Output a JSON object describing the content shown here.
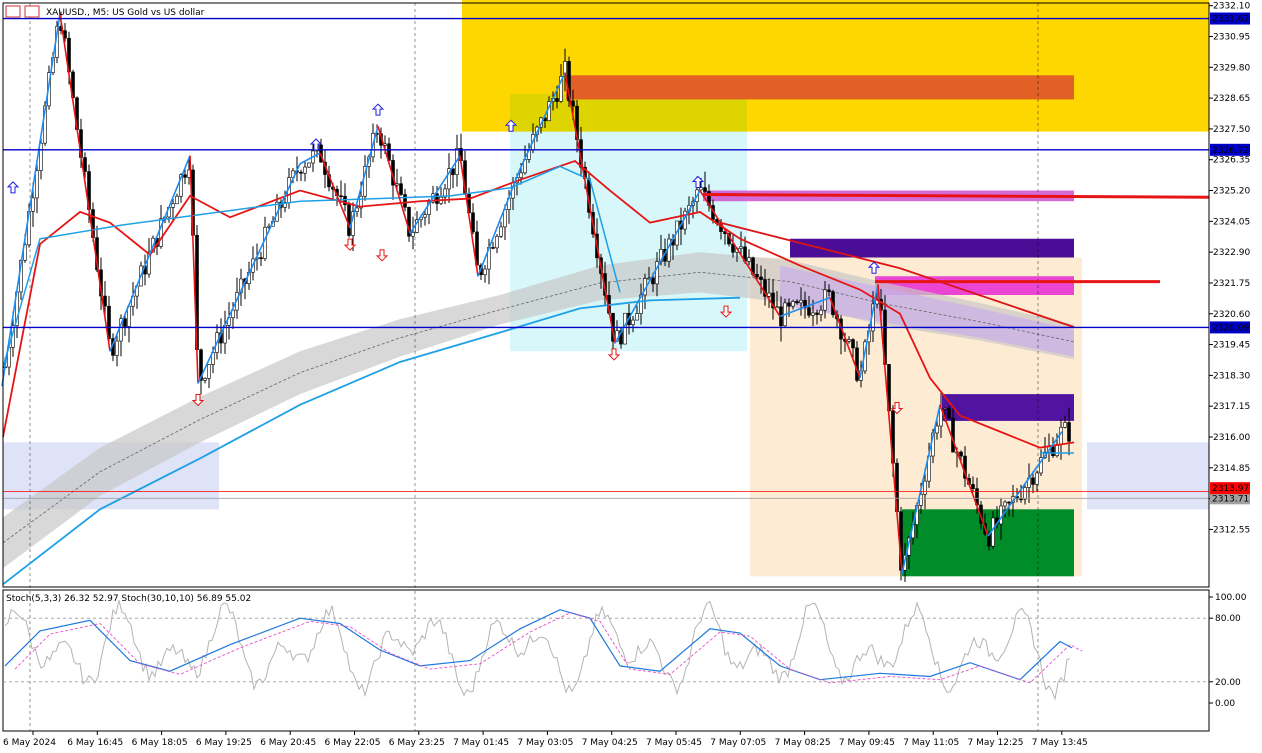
{
  "header": {
    "symbol_text": "XAUUSD., M5:  US Gold vs US dollar"
  },
  "chart_data": {
    "type": "candlestick",
    "symbol": "XAUUSD.",
    "timeframe": "M5",
    "description": "US Gold vs US dollar",
    "price_axis": {
      "ticks": [
        "2332.10",
        "2330.95",
        "2329.80",
        "2328.65",
        "2327.50",
        "2326.35",
        "2325.20",
        "2324.05",
        "2322.90",
        "2321.75",
        "2320.60",
        "2319.45",
        "2318.30",
        "2317.15",
        "2316.00",
        "2314.85",
        "2313.70",
        "2312.55"
      ],
      "ylim": [
        2310.4,
        2332.2
      ]
    },
    "time_axis": {
      "ticks": [
        "6 May 2024",
        "6 May 16:45",
        "6 May 18:05",
        "6 May 19:25",
        "6 May 20:45",
        "6 May 22:05",
        "6 May 23:25",
        "7 May 01:45",
        "7 May 03:05",
        "7 May 04:25",
        "7 May 05:45",
        "7 May 07:05",
        "7 May 08:25",
        "7 May 09:45",
        "7 May 11:05",
        "7 May 12:25",
        "7 May 13:45"
      ]
    },
    "horizontal_lines": [
      {
        "price": 2331.62,
        "label": "2331.62",
        "color": "#0000c8"
      },
      {
        "price": 2326.72,
        "label": "2326.72",
        "color": "#0000c8"
      },
      {
        "price": 2320.09,
        "label": "2320.09",
        "color": "#0000c8"
      }
    ],
    "price_tags": [
      {
        "price": 2313.97,
        "label": "2313.97",
        "color": "#ff0000"
      },
      {
        "price": 2313.71,
        "label": "2313.71",
        "color": "#a0a0a0"
      }
    ],
    "zigzag_points": [
      [
        2,
        2317.9
      ],
      [
        60,
        2331.8
      ],
      [
        110,
        2319.2
      ],
      [
        190,
        2326.5
      ],
      [
        198,
        2318.0
      ],
      [
        300,
        2326.2
      ],
      [
        320,
        2326.6
      ],
      [
        350,
        2323.8
      ],
      [
        378,
        2327.6
      ],
      [
        410,
        2323.6
      ],
      [
        460,
        2326.5
      ],
      [
        478,
        2322.0
      ],
      [
        520,
        2326.0
      ],
      [
        565,
        2329.6
      ],
      [
        615,
        2319.5
      ],
      [
        700,
        2325.2
      ],
      [
        780,
        2320.5
      ],
      [
        830,
        2321.2
      ],
      [
        860,
        2318.2
      ],
      [
        878,
        2321.7
      ],
      [
        902,
        2310.9
      ],
      [
        940,
        2317.2
      ],
      [
        988,
        2312.3
      ],
      [
        1062,
        2316.2
      ]
    ],
    "oscillator": {
      "label": "Stoch(5,3,3) 26.32 52.97 Stoch(30,10,10) 56.89 55.02",
      "ticks": [
        "100.00",
        "80.00",
        "20.00",
        "0.00"
      ],
      "levels": [
        80,
        20
      ],
      "ylim": [
        0,
        100
      ]
    },
    "colors": {
      "ma_fast": "#e61414",
      "ma_slow": "#1ea0e6",
      "zigzag": "#1e8cf0",
      "zigzag_down": "#e61414",
      "supply_zone": "#ffd700",
      "demand_zone": "#00a000",
      "purple_zone": "#4b0c96",
      "magenta_zone": "#d25ad2"
    }
  }
}
